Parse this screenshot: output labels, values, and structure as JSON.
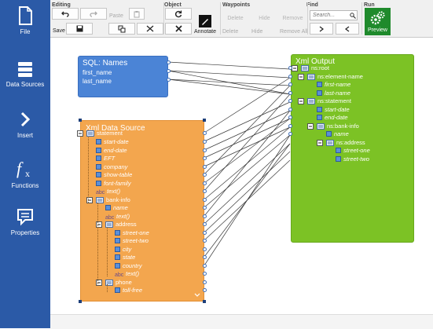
{
  "sidebar": {
    "items": [
      {
        "label": "File",
        "icon": "file-icon"
      },
      {
        "label": "Data Sources",
        "icon": "database-icon"
      },
      {
        "label": "Insert",
        "icon": "chevron-right-icon"
      },
      {
        "label": "Functions",
        "icon": "function-fx-icon"
      },
      {
        "label": "Properties",
        "icon": "properties-icon"
      }
    ]
  },
  "ribbon": {
    "groups": {
      "editing": "Editing",
      "object": "Object",
      "waypoints": "Waypoints",
      "find": "Find",
      "run": "Run"
    },
    "editing": {
      "undo": "undo-icon",
      "redo": "redo-icon",
      "paste": "Paste",
      "clipboard": "clipboard-icon",
      "save": "Save"
    },
    "object": {
      "annotate": "Annotate"
    },
    "waypoints": {
      "delete": "Delete",
      "hide": "Hide",
      "remove": "Remove",
      "remove_all": "Remove All"
    },
    "find": {
      "placeholder": "Search..."
    },
    "run": {
      "preview": "Preview"
    }
  },
  "sql_box": {
    "title": "SQL: Names",
    "fields": [
      "first_name",
      "last_name"
    ]
  },
  "xml_source": {
    "title": "Xml Data Source",
    "nodes": [
      "statement",
      "start-date",
      "end-date",
      "EFT",
      "company",
      "show-table",
      "font-family",
      "text()",
      "bank-info",
      "name",
      "text()",
      "address",
      "street-one",
      "street-two",
      "city",
      "state",
      "country",
      "text()",
      "phone",
      "toll-free"
    ]
  },
  "xml_output": {
    "title": "Xml Output",
    "nodes": [
      "ns:root",
      "ns:element-name",
      "first-name",
      "last-name",
      "ns:statement",
      "start-date",
      "end-date",
      "ns:bank-info",
      "name",
      "ns:address",
      "street-one",
      "street-two"
    ]
  },
  "colors": {
    "sidebar": "#2b5aa7",
    "sql": "#4b84d6",
    "source": "#f3a64e",
    "output": "#7cc225",
    "run": "#1f8a2c",
    "connector": "#3a3a3a"
  }
}
